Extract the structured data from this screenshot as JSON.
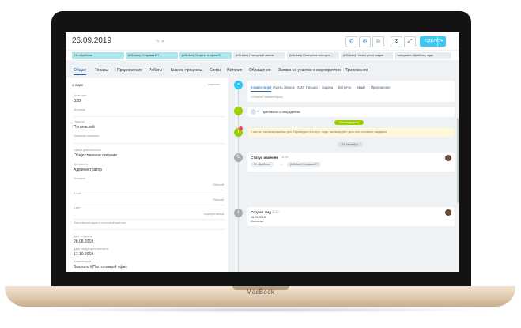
{
  "device": {
    "brand": "MacBook"
  },
  "header": {
    "title": "26.09.2019",
    "save_label": "СДЕЛКУ",
    "buttons": [
      "phone-icon",
      "mail-icon",
      "copy-icon",
      "gear-icon",
      "expand-icon"
    ]
  },
  "pipeline": [
    {
      "label": "Не обработан",
      "color": "#ace5ec"
    },
    {
      "label": "(b2b-tiam) Отправка КП",
      "color": "#ace5ec"
    },
    {
      "label": "(b2b-tiam) Встреча в офисе/б",
      "color": "#ace5ec"
    },
    {
      "label": "(b2b-tiam) Повторный звонок",
      "color": "#e8ecef"
    },
    {
      "label": "(b2b-tiam) Повторная посещен...",
      "color": "#e8ecef"
    },
    {
      "label": "(b2b-tiam) Готов к регистрации",
      "color": "#e8ecef"
    },
    {
      "label": "Завершить обработку лида",
      "color": "#e8ecef"
    }
  ],
  "tabs": [
    "Общие",
    "Товары",
    "Продолжение",
    "Работы",
    "Бизнес-процессы",
    "Связи",
    "История",
    "Обращения",
    "Заявки на участие в мероприятии",
    "Приложения"
  ],
  "left": {
    "section_title": "о лиде",
    "section_action": "изменить",
    "fields": [
      {
        "label": "Категория",
        "value": "B2B"
      },
      {
        "label": "Источник",
        "value": ""
      },
      {
        "label": "Отрасль",
        "value": "Пупкевский"
      },
      {
        "label": "Название компании",
        "value": ""
      },
      {
        "label": "Сфера деятельности",
        "value": "Общественное питание"
      },
      {
        "label": "Должность",
        "value": "Администратор"
      },
      {
        "label": "Телефон",
        "value": "",
        "right": "Рабочий"
      },
      {
        "label": "E-mail",
        "value": "",
        "right": "Рабочий"
      },
      {
        "label": "Сайт",
        "value": "",
        "right": "Корпоративный"
      },
      {
        "label": "Фактический адрес в голосовой карточке",
        "value": ""
      },
      {
        "label": "Дата создания",
        "value": "26.08.2019"
      },
      {
        "label": "Дата следующего контакта",
        "value": "17.10.2019"
      },
      {
        "label": "Комментарий",
        "value": "Выслать КП в головной офис"
      }
    ]
  },
  "right": {
    "composer_tabs": [
      "Комментарий",
      "Ждать",
      "Звонок",
      "SMS",
      "Письмо",
      "Задача",
      "Встреча",
      "Визит",
      "Приложение"
    ],
    "composer_placeholder": "Оставьте комментарий",
    "invite_label": "Пригласить к обсуждению",
    "scheduled_pill": "Запланировано",
    "warning_text": "У вас нет запланированных дел. Переведите в статус: лиды, запланируйте дело или поставьте ожидание.",
    "date_pill": "26 сентября",
    "events": [
      {
        "title": "Статус изменён",
        "time": "11:15",
        "from": "Не обработан",
        "to": "(b2b-tiam) Отправка КП"
      },
      {
        "title": "Создан лид",
        "time": "11:10",
        "date": "26.09.2019",
        "note": "Источник"
      }
    ]
  }
}
